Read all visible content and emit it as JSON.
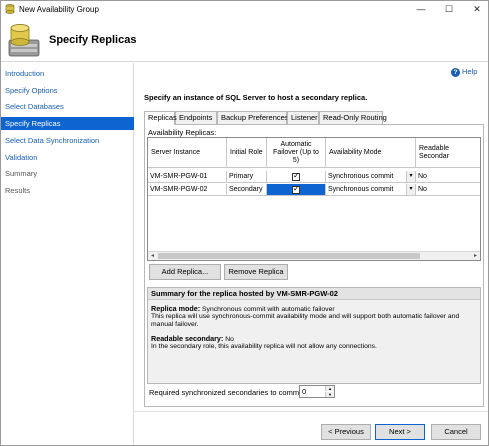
{
  "window": {
    "title": "New Availability Group",
    "minimize": "—",
    "maximize": "☐",
    "close": "✕"
  },
  "header": {
    "title": "Specify Replicas"
  },
  "sidebar": {
    "items": [
      {
        "label": "Introduction",
        "state": "link"
      },
      {
        "label": "Specify Options",
        "state": "link"
      },
      {
        "label": "Select Databases",
        "state": "link"
      },
      {
        "label": "Specify Replicas",
        "state": "active"
      },
      {
        "label": "Select Data Synchronization",
        "state": "link"
      },
      {
        "label": "Validation",
        "state": "link"
      },
      {
        "label": "Summary",
        "state": "disabled"
      },
      {
        "label": "Results",
        "state": "disabled"
      }
    ]
  },
  "help": {
    "label": "Help"
  },
  "instruction": "Specify an instance of SQL Server to host a secondary replica.",
  "tabs": [
    "Replicas",
    "Endpoints",
    "Backup Preferences",
    "Listener",
    "Read-Only Routing"
  ],
  "grid": {
    "caption": "Availability Replicas:",
    "headers": [
      "Server Instance",
      "Initial Role",
      "Automatic Failover (Up to 5)",
      "Availability Mode",
      "Readable Secondar"
    ],
    "rows": [
      {
        "server": "VM-SMR-PGW-01",
        "role": "Primary",
        "failover": true,
        "mode": "Synchronous commit",
        "readable": "No"
      },
      {
        "server": "VM-SMR-PGW-02",
        "role": "Secondary",
        "failover": true,
        "mode": "Synchronous commit",
        "readable": "No"
      }
    ],
    "dropdown_arrow": "▾",
    "check": "✓"
  },
  "scrollbar": {
    "left": "◂",
    "right": "▸"
  },
  "buttons": {
    "add_replica": "Add Replica...",
    "remove_replica": "Remove Replica",
    "previous": "< Previous",
    "next": "Next >",
    "cancel": "Cancel"
  },
  "summary": {
    "heading": "Summary for the replica hosted by VM-SMR-PGW-02",
    "replica_mode_label": "Replica mode:",
    "replica_mode_value": " Synchronous commit with automatic failover",
    "replica_mode_desc": "This replica will use synchronous-commit availability mode and will support both automatic failover and manual failover.",
    "readable_label": "Readable secondary:",
    "readable_value": " No",
    "readable_desc": "In the secondary role, this availability replica will not allow any connections."
  },
  "required_secondaries": {
    "label": "Required synchronized secondaries to commit",
    "value": "0",
    "up": "▲",
    "down": "▼"
  }
}
